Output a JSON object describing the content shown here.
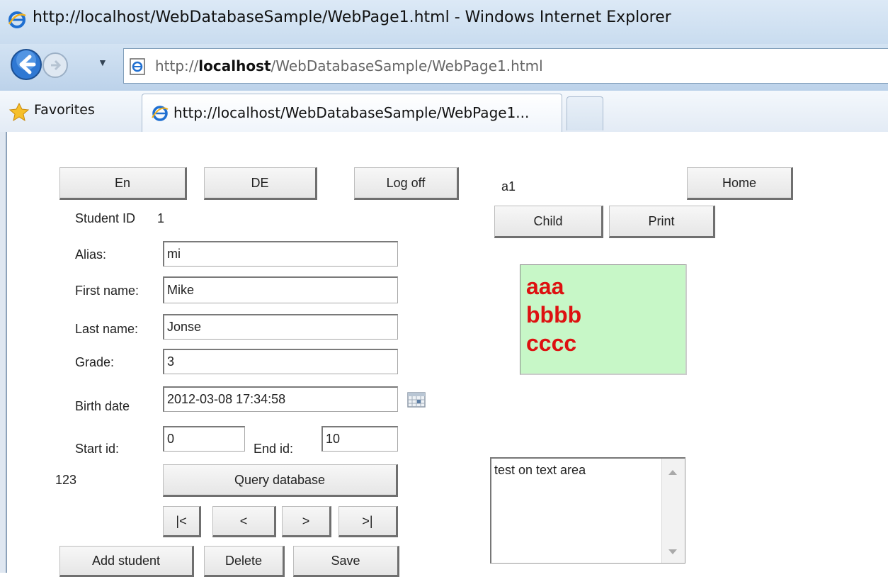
{
  "window": {
    "title": "http://localhost/WebDatabaseSample/WebPage1.html - Windows Internet Explorer"
  },
  "address_bar": {
    "url_prefix": "http://",
    "url_host": "localhost",
    "url_path": "/WebDatabaseSample/WebPage1.html"
  },
  "favorites_bar": {
    "favorites_label": "Favorites",
    "active_tab_label": "http://localhost/WebDatabaseSample/WebPage1..."
  },
  "top_buttons": {
    "en_label": "En",
    "de_label": "DE",
    "logoff_label": "Log off",
    "home_label": "Home",
    "child_label": "Child",
    "print_label": "Print"
  },
  "user_label": "a1",
  "form": {
    "student_id_label": "Student ID",
    "student_id_value": "1",
    "alias_label": "Alias:",
    "alias_value": "mi",
    "first_name_label": "First name:",
    "first_name_value": "Mike",
    "last_name_label": "Last name:",
    "last_name_value": "Jonse",
    "grade_label": "Grade:",
    "grade_value": "3",
    "birth_date_label": "Birth date",
    "birth_date_value": "2012-03-08 17:34:58",
    "start_id_label": "Start id:",
    "start_id_value": "0",
    "end_id_label": "End id:",
    "end_id_value": "10",
    "count_label": "123",
    "query_button_label": "Query database"
  },
  "pager": {
    "first_label": "|<",
    "prev_label": "<",
    "next_label": ">",
    "last_label": ">|"
  },
  "actions": {
    "add_label": "Add student",
    "delete_label": "Delete",
    "save_label": "Save"
  },
  "list_box": {
    "items": [
      "aaa",
      "bbbb",
      "cccc"
    ],
    "background_color": "#c7f7c7",
    "text_color": "#dd1111"
  },
  "text_area": {
    "value": "test on text area"
  }
}
